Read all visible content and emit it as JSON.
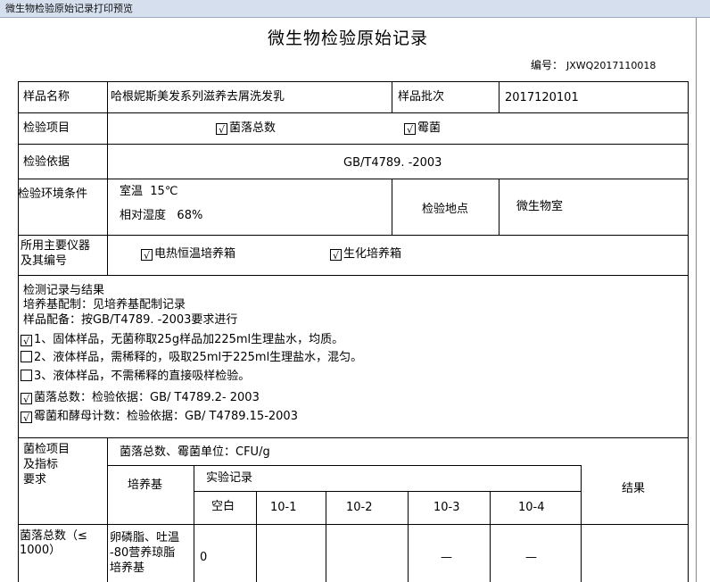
{
  "window": {
    "title": "微生物检验原始记录打印预览"
  },
  "document": {
    "title": "微生物检验原始记录",
    "number_label": "编号：",
    "number_value": "JXWQ2017110018"
  },
  "sample": {
    "name_label": "样品名称",
    "name_value": "哈根妮斯美发系列滋养去屑洗发乳",
    "batch_label": "样品批次",
    "batch_value": "2017120101"
  },
  "items": {
    "label": "检验项目",
    "mark": "√",
    "item1": "菌落总数",
    "item2": "霉菌"
  },
  "basis": {
    "label": "检验依据",
    "value": "GB/T4789. -2003"
  },
  "env": {
    "label": "检验环境条件",
    "temp_label": "室温",
    "temp_value": "15℃",
    "hum_label": "相对湿度",
    "hum_value": "68%",
    "place_label": "检验地点",
    "place_value": "微生物室"
  },
  "instruments": {
    "label_line1": "所用主要仪器",
    "label_line2": "及其编号",
    "mark": "√",
    "inst1": "电热恒温培养箱",
    "inst2": "生化培养箱"
  },
  "record": {
    "line1": "检测记录与结果",
    "line2": "培养基配制：见培养基配制记录",
    "line3": "样品配备：按GB/T4789.  -2003要求进行",
    "opts": [
      {
        "mark": "√",
        "text": "1、固体样品，无菌称取25g样品加225ml生理盐水，均质。"
      },
      {
        "mark": "",
        "text": "2、液体样品，需稀释的，吸取25ml于225ml生理盐水，混匀。"
      },
      {
        "mark": "",
        "text": "3、液体样品，不需稀释的直接吸样检验。"
      },
      {
        "mark": "√",
        "text": "菌落总数：检验依据：GB/ T4789.2- 2003"
      },
      {
        "mark": "√",
        "text": "霉菌和酵母计数：检验依据：GB/ T4789.15-2003"
      }
    ]
  },
  "results": {
    "req_line1": "菌检项目",
    "req_line2": "及指标",
    "req_line3": "要求",
    "unit": "菌落总数、霉菌单位：CFU/g",
    "medium_header": "培养基",
    "exp_header": "实验记录",
    "result_header": "结果",
    "cols": [
      "空白",
      "10-1",
      "10-2",
      "10-3",
      "10-4"
    ],
    "row1": {
      "item_line1": "菌落总数（≤",
      "item_line2": "1000）",
      "medium_line1": "卵磷脂、吐温",
      "medium_line2": "-80营养琼脂",
      "medium_line3": "培养基",
      "blank": "0",
      "d3": "—",
      "d4": "—"
    }
  }
}
